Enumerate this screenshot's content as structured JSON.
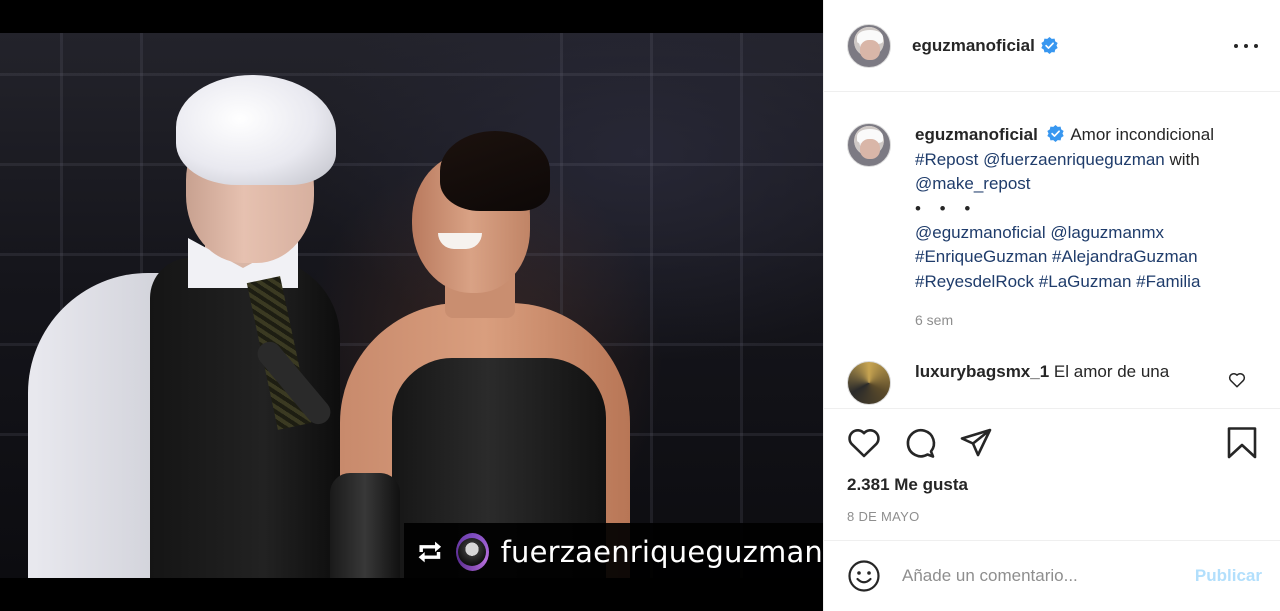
{
  "post": {
    "photo_description_icon": "concert-photo",
    "repost_overlay_user": "fuerzaenriqueguzman"
  },
  "header": {
    "username": "eguzmanoficial",
    "verified_icon": "verified-badge-icon",
    "more_icon": "more-options-icon"
  },
  "caption": {
    "username": "eguzmanoficial",
    "text": "Amor incondicional",
    "line2_tag": "#Repost",
    "line2_mention": "@fuerzaenriqueguzman",
    "line2_text": "with",
    "line3_mention": "@make_repost",
    "dots": "• • •",
    "mentions_line": [
      "@eguzmanoficial",
      "@laguzmanmx"
    ],
    "hashtags_line1": [
      "#EnriqueGuzman",
      "#AlejandraGuzman"
    ],
    "hashtags_line2": [
      "#ReyesdelRock",
      "#LaGuzman",
      "#Familia"
    ],
    "time": "6 sem"
  },
  "comments": [
    {
      "username": "luxurybagsmx_1",
      "text": "El amor de una"
    }
  ],
  "actions": {
    "likes": "2.381 Me gusta",
    "date": "8 DE MAYO"
  },
  "composer": {
    "placeholder": "Añade un comentario...",
    "publish_label": "Publicar"
  },
  "colors": {
    "link": "#1f3c6b",
    "verified": "#3897f0",
    "muted": "#8e8e8e",
    "publish_disabled": "#b2dffc"
  }
}
